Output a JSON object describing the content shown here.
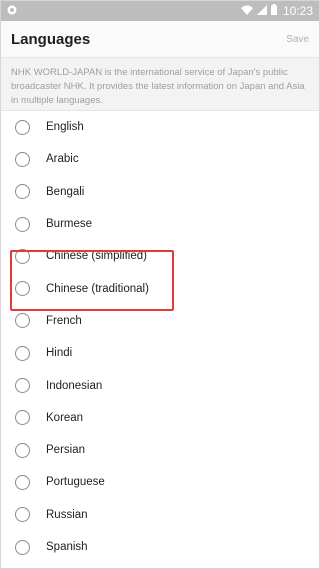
{
  "status_bar": {
    "time": "10:23",
    "icons": [
      "notification-icon",
      "wifi-icon",
      "signal-icon",
      "battery-icon"
    ]
  },
  "header": {
    "title": "Languages",
    "save_label": "Save"
  },
  "description": "NHK WORLD-JAPAN is the international service of Japan's public broadcaster NHK. It provides the latest information on Japan and Asia in multiple languages.",
  "languages": [
    {
      "label": "English",
      "selected": false
    },
    {
      "label": "Arabic",
      "selected": false
    },
    {
      "label": "Bengali",
      "selected": false
    },
    {
      "label": "Burmese",
      "selected": false
    },
    {
      "label": "Chinese (simplified)",
      "selected": false
    },
    {
      "label": "Chinese (traditional)",
      "selected": false
    },
    {
      "label": "French",
      "selected": false
    },
    {
      "label": "Hindi",
      "selected": false
    },
    {
      "label": "Indonesian",
      "selected": false
    },
    {
      "label": "Korean",
      "selected": false
    },
    {
      "label": "Persian",
      "selected": false
    },
    {
      "label": "Portuguese",
      "selected": false
    },
    {
      "label": "Russian",
      "selected": false
    },
    {
      "label": "Spanish",
      "selected": false
    }
  ],
  "colors": {
    "highlight": "#e53935",
    "status_bar": "#bdbdbd"
  }
}
